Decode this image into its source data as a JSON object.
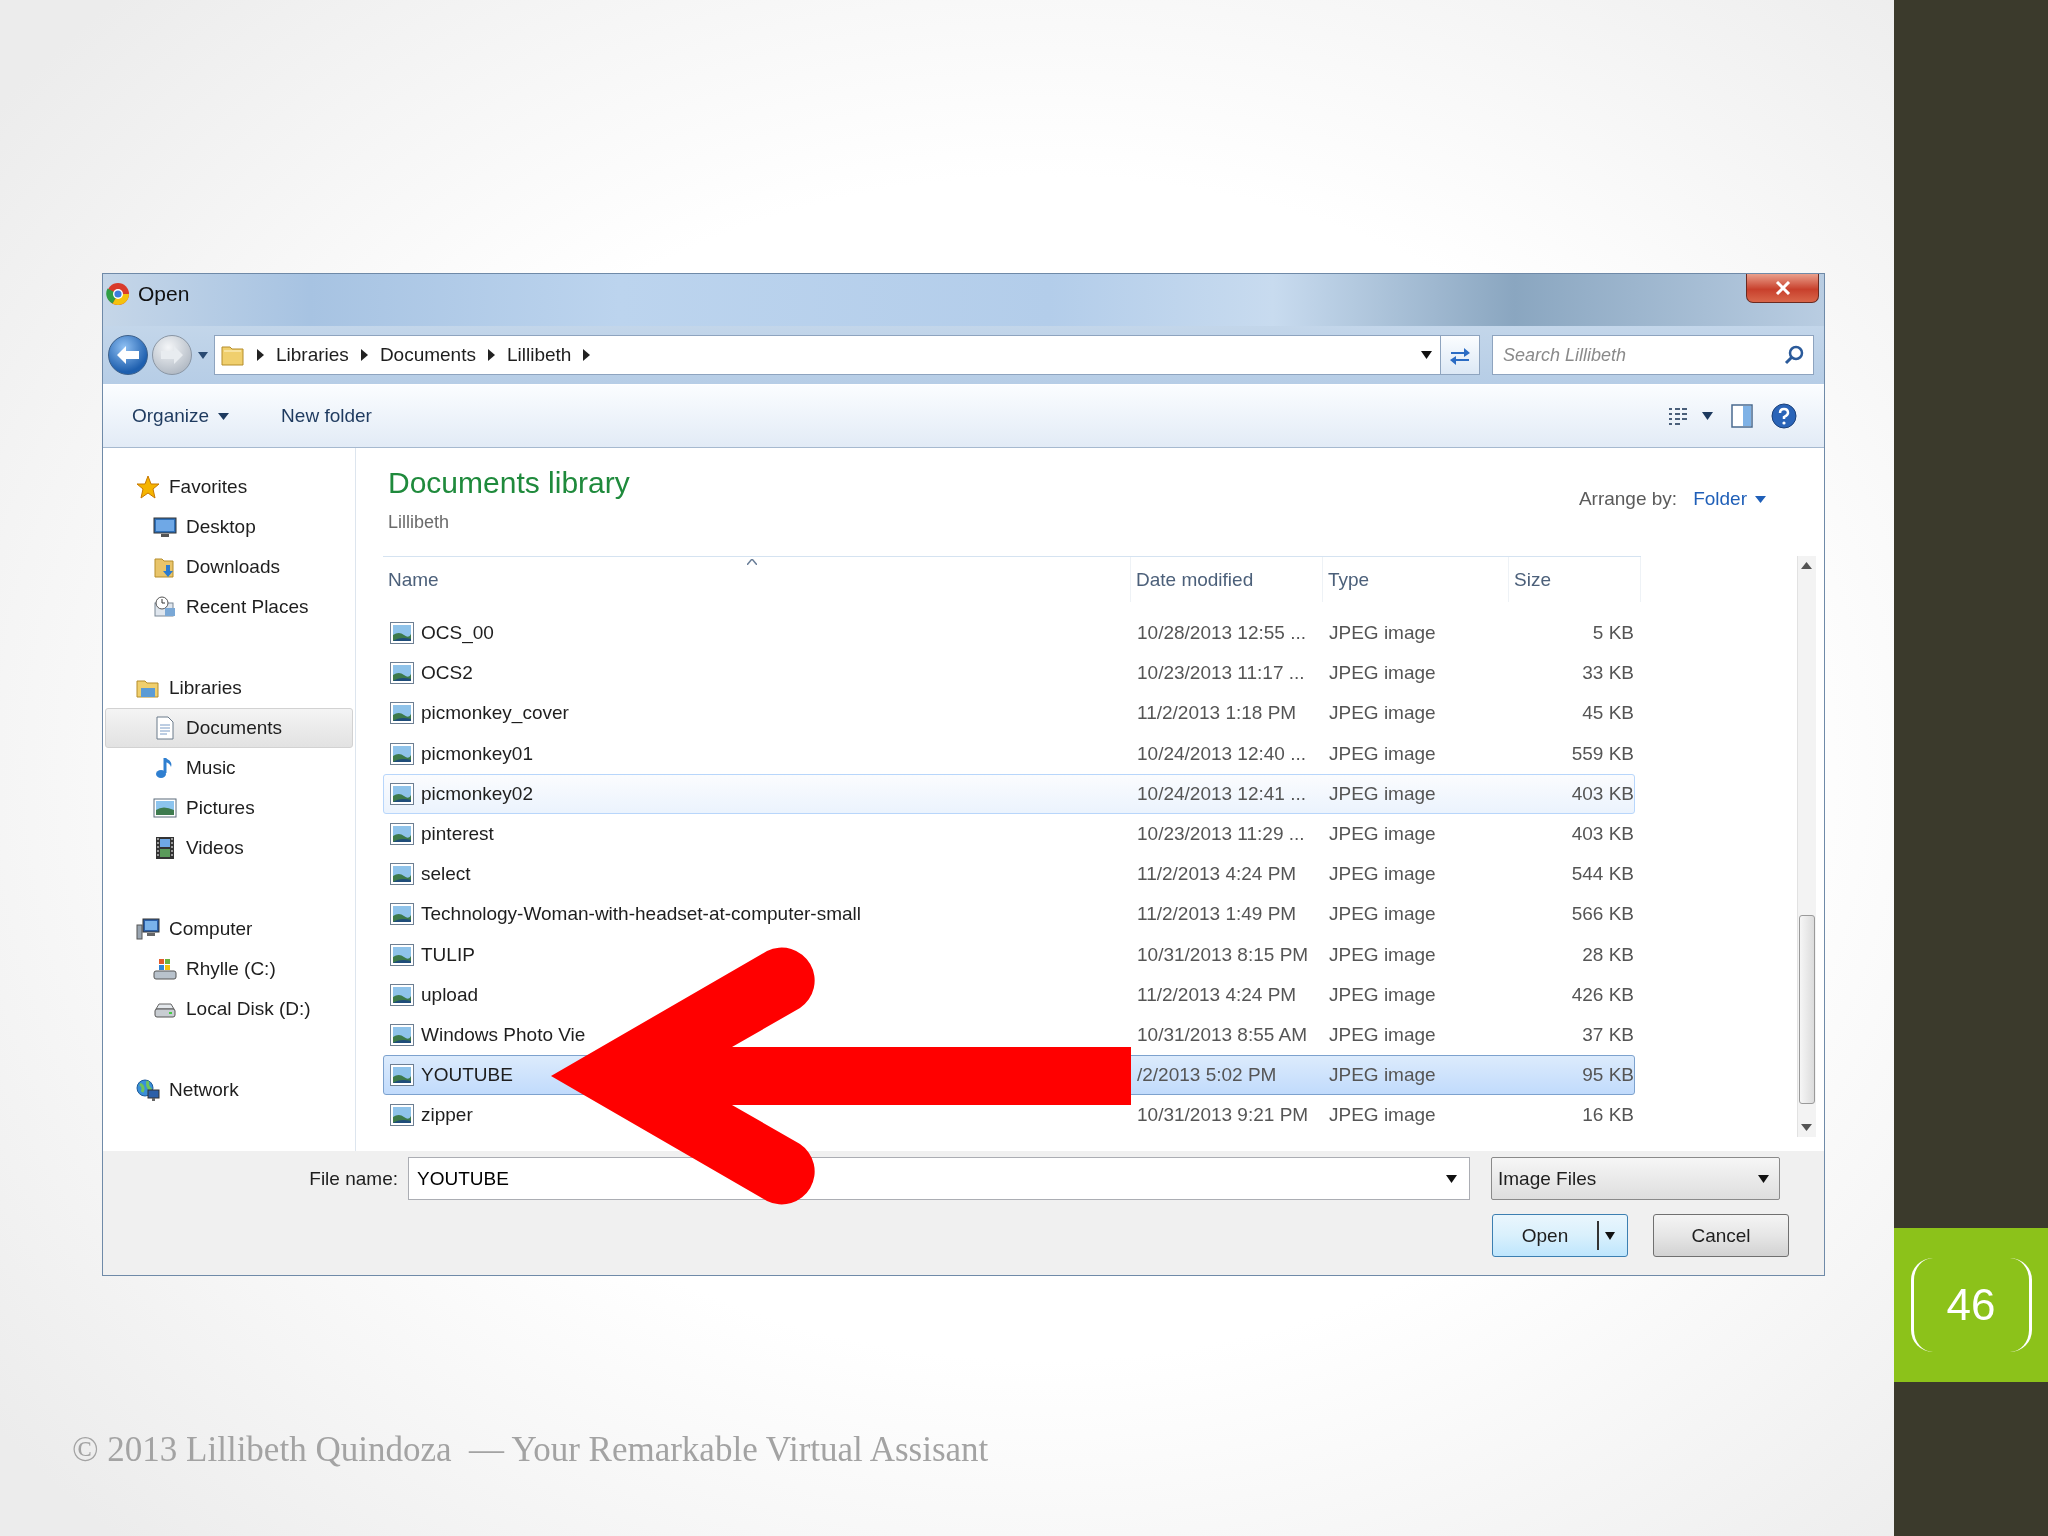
{
  "window": {
    "title": "Open"
  },
  "address": {
    "crumbs": [
      "Libraries",
      "Documents",
      "Lillibeth"
    ],
    "search_placeholder": "Search Lillibeth"
  },
  "toolbar": {
    "organize": "Organize",
    "new_folder": "New folder"
  },
  "nav_pane": [
    {
      "label": "Favorites",
      "kind": "star",
      "selected": false,
      "children": [
        {
          "label": "Desktop",
          "kind": "desktop",
          "selected": false
        },
        {
          "label": "Downloads",
          "kind": "downloads",
          "selected": false
        },
        {
          "label": "Recent Places",
          "kind": "recent",
          "selected": false
        }
      ]
    },
    {
      "label": "Libraries",
      "kind": "library",
      "selected": false,
      "children": [
        {
          "label": "Documents",
          "kind": "document",
          "selected": true
        },
        {
          "label": "Music",
          "kind": "music",
          "selected": false
        },
        {
          "label": "Pictures",
          "kind": "pictures",
          "selected": false
        },
        {
          "label": "Videos",
          "kind": "videos",
          "selected": false
        }
      ]
    },
    {
      "label": "Computer",
      "kind": "computer",
      "selected": false,
      "children": [
        {
          "label": "Rhylle (C:)",
          "kind": "drive",
          "selected": false
        },
        {
          "label": "Local Disk (D:)",
          "kind": "disk",
          "selected": false
        }
      ]
    },
    {
      "label": "Network",
      "kind": "network",
      "selected": false
    }
  ],
  "library": {
    "title": "Documents library",
    "subtitle": "Lillibeth",
    "arrange_label": "Arrange by:",
    "arrange_value": "Folder"
  },
  "columns": [
    "Name",
    "Date modified",
    "Type",
    "Size"
  ],
  "files": [
    {
      "name": "OCS_00",
      "date": "10/28/2013 12:55 ...",
      "type": "JPEG image",
      "size": "5 KB",
      "selected": false,
      "highlighted": false
    },
    {
      "name": "OCS2",
      "date": "10/23/2013 11:17 ...",
      "type": "JPEG image",
      "size": "33 KB",
      "selected": false,
      "highlighted": false
    },
    {
      "name": "picmonkey_cover",
      "date": "11/2/2013 1:18 PM",
      "type": "JPEG image",
      "size": "45 KB",
      "selected": false,
      "highlighted": false
    },
    {
      "name": "picmonkey01",
      "date": "10/24/2013 12:40 ...",
      "type": "JPEG image",
      "size": "559 KB",
      "selected": false,
      "highlighted": false
    },
    {
      "name": "picmonkey02",
      "date": "10/24/2013 12:41 ...",
      "type": "JPEG image",
      "size": "403 KB",
      "selected": false,
      "highlighted": true
    },
    {
      "name": "pinterest",
      "date": "10/23/2013 11:29 ...",
      "type": "JPEG image",
      "size": "403 KB",
      "selected": false,
      "highlighted": false
    },
    {
      "name": "select",
      "date": "11/2/2013 4:24 PM",
      "type": "JPEG image",
      "size": "544 KB",
      "selected": false,
      "highlighted": false
    },
    {
      "name": "Technology-Woman-with-headset-at-computer-small",
      "date": "11/2/2013 1:49 PM",
      "type": "JPEG image",
      "size": "566 KB",
      "selected": false,
      "highlighted": false
    },
    {
      "name": "TULIP",
      "date": "10/31/2013 8:15 PM",
      "type": "JPEG image",
      "size": "28 KB",
      "selected": false,
      "highlighted": false
    },
    {
      "name": "upload",
      "date": "11/2/2013 4:24 PM",
      "type": "JPEG image",
      "size": "426 KB",
      "selected": false,
      "highlighted": false
    },
    {
      "name": "Windows Photo Vie",
      "date": "10/31/2013 8:55 AM",
      "type": "JPEG image",
      "size": "37 KB",
      "selected": false,
      "highlighted": false
    },
    {
      "name": "YOUTUBE",
      "date": "/2/2013 5:02 PM",
      "type": "JPEG image",
      "size": "95 KB",
      "selected": true,
      "highlighted": false
    },
    {
      "name": "zipper",
      "date": "10/31/2013 9:21 PM",
      "type": "JPEG image",
      "size": "16 KB",
      "selected": false,
      "highlighted": false
    }
  ],
  "footer_bar": {
    "file_name_label": "File name:",
    "file_name": "YOUTUBE",
    "filter": "Image Files",
    "buttons": [
      "Open",
      "Cancel"
    ]
  },
  "slide": {
    "page_number": "46",
    "footer": "© 2013 Lillibeth Quindoza  — Your Remarkable Virtual Assisant"
  }
}
